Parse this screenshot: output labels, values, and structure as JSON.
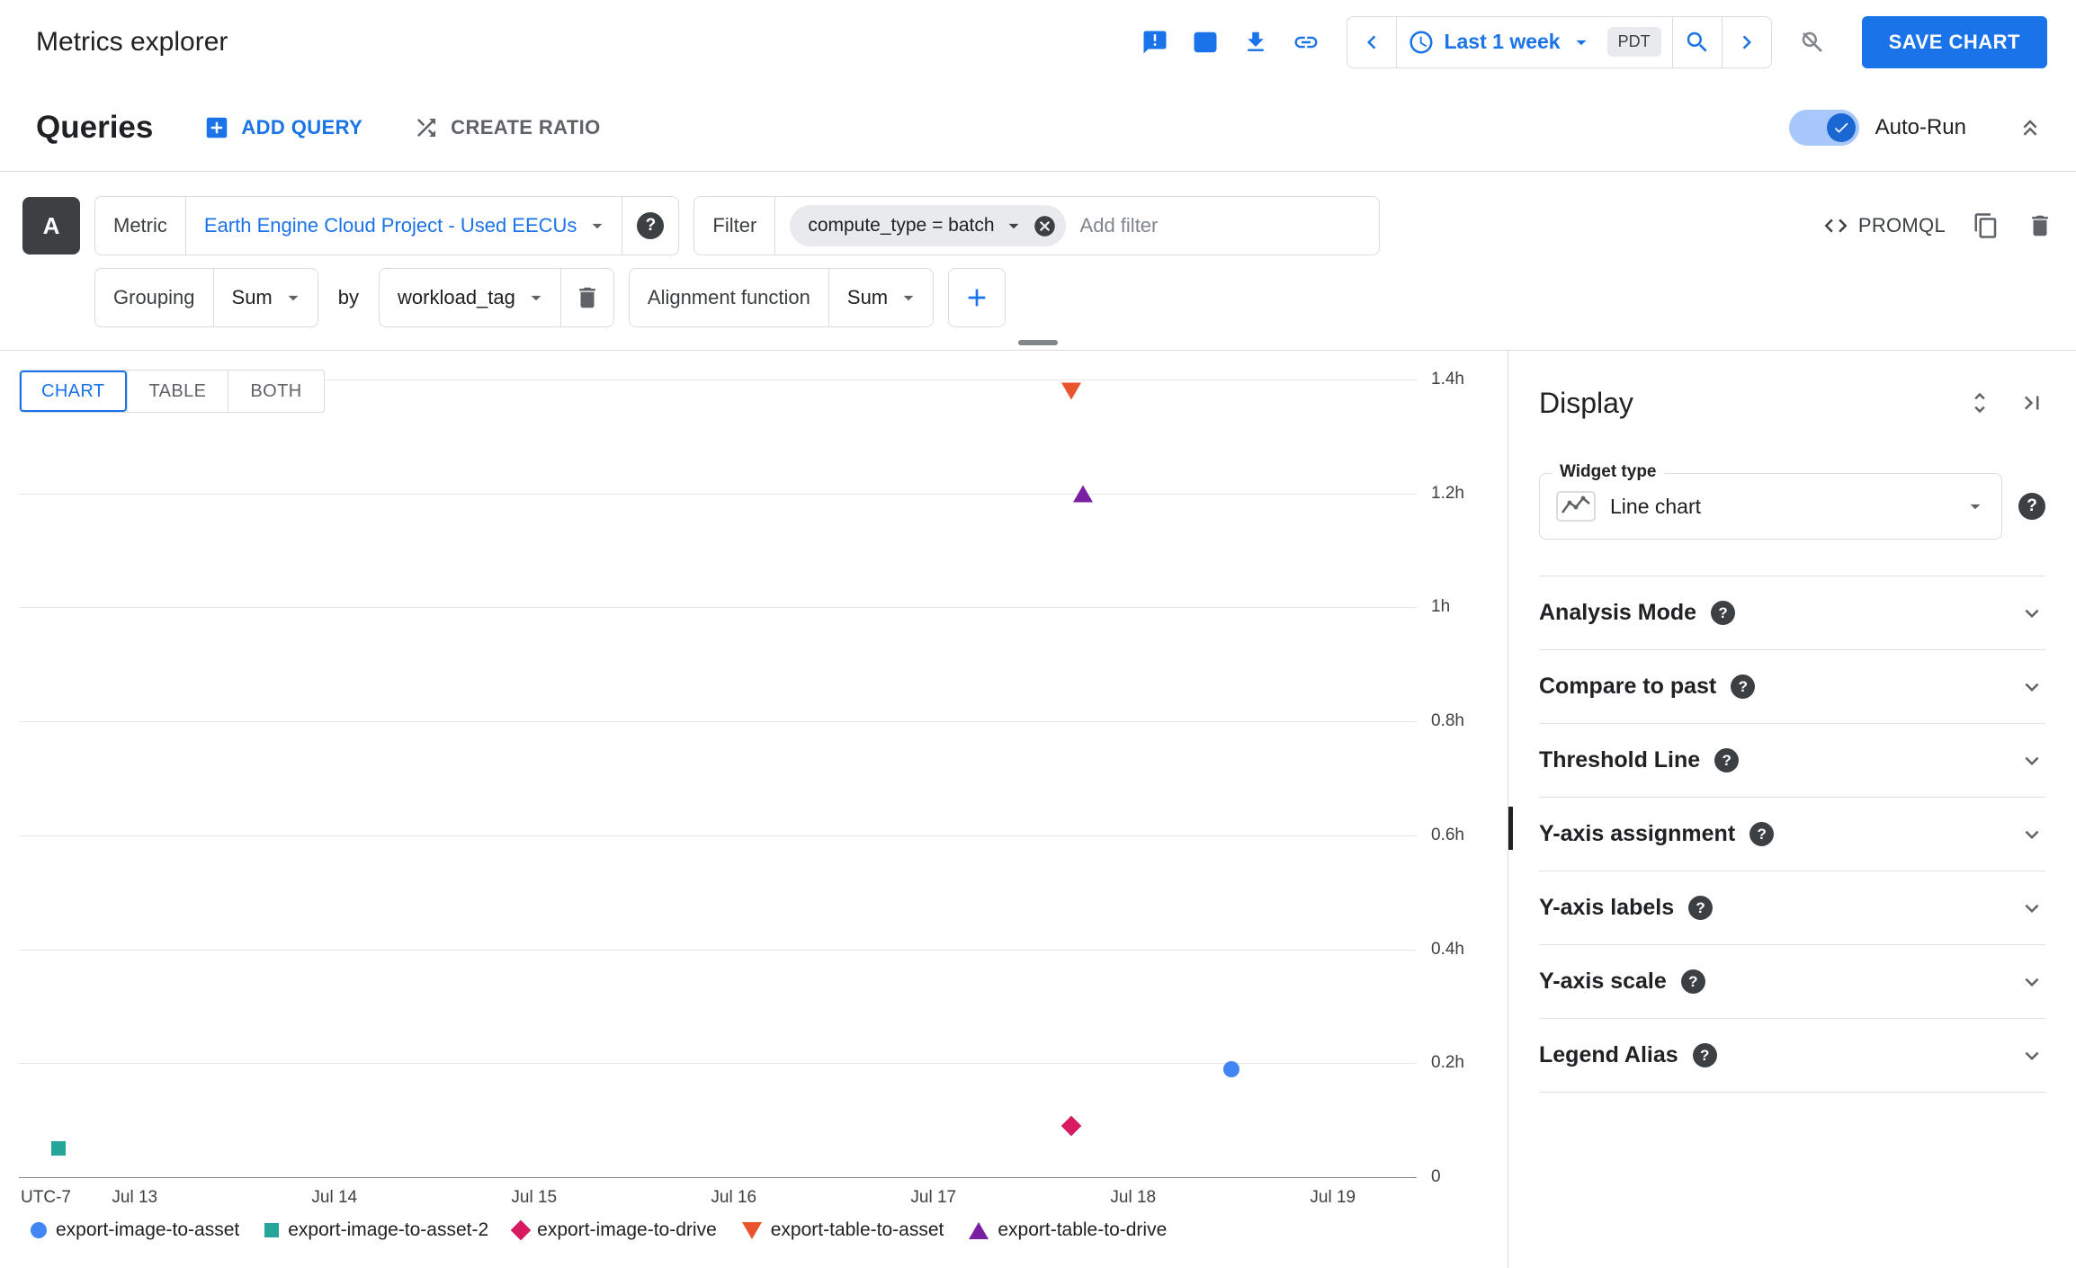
{
  "header": {
    "title": "Metrics explorer",
    "time_range": {
      "label": "Last 1 week",
      "timezone": "PDT"
    },
    "save_button": "SAVE CHART"
  },
  "queries_bar": {
    "title": "Queries",
    "add_query_label": "ADD QUERY",
    "create_ratio_label": "CREATE RATIO",
    "autorun_label": "Auto-Run",
    "autorun_enabled": true
  },
  "query": {
    "badge": "A",
    "metric_label": "Metric",
    "metric_value": "Earth Engine Cloud Project - Used EECUs",
    "filter_label": "Filter",
    "filter_chip": "compute_type = batch",
    "add_filter_placeholder": "Add filter",
    "promql_label": "PROMQL",
    "grouping_label": "Grouping",
    "grouping_value": "Sum",
    "by_label": "by",
    "group_by_value": "workload_tag",
    "alignment_label": "Alignment function",
    "alignment_value": "Sum"
  },
  "view_tabs": [
    {
      "label": "CHART",
      "active": true
    },
    {
      "label": "TABLE",
      "active": false
    },
    {
      "label": "BOTH",
      "active": false
    }
  ],
  "chart_data": {
    "type": "scatter",
    "title": "",
    "xlabel": "",
    "ylabel": "",
    "x_axis_prefix_label": "UTC-7",
    "x_ticks": [
      "Jul 13",
      "Jul 14",
      "Jul 15",
      "Jul 16",
      "Jul 17",
      "Jul 18",
      "Jul 19"
    ],
    "x_tick_days": [
      13,
      14,
      15,
      16,
      17,
      18,
      19
    ],
    "x_range_days": [
      12.42,
      19.42
    ],
    "y_ticks": [
      "1.4h",
      "1.2h",
      "1h",
      "0.8h",
      "0.6h",
      "0.4h",
      "0.2h",
      "0"
    ],
    "y_tick_values": [
      1.4,
      1.2,
      1,
      0.8,
      0.6,
      0.4,
      0.2,
      0
    ],
    "y_range": [
      0,
      1.4
    ],
    "y_unit": "hours",
    "grid": true,
    "legend_position": "bottom",
    "series": [
      {
        "name": "export-image-to-asset",
        "marker": "circle",
        "color": "#4285f4",
        "points": [
          {
            "x_day": 18.49,
            "y_hours": 0.19
          }
        ]
      },
      {
        "name": "export-image-to-asset-2",
        "marker": "square",
        "color": "#26a69a",
        "points": [
          {
            "x_day": 12.62,
            "y_hours": 0.05
          }
        ]
      },
      {
        "name": "export-image-to-drive",
        "marker": "diamond",
        "color": "#d81b60",
        "points": [
          {
            "x_day": 17.69,
            "y_hours": 0.09
          }
        ]
      },
      {
        "name": "export-table-to-asset",
        "marker": "triangle-down",
        "color": "#e8542c",
        "points": [
          {
            "x_day": 17.69,
            "y_hours": 1.38
          }
        ]
      },
      {
        "name": "export-table-to-drive",
        "marker": "triangle-up",
        "color": "#7b1fa2",
        "points": [
          {
            "x_day": 17.75,
            "y_hours": 1.2
          }
        ]
      }
    ]
  },
  "display_panel": {
    "title": "Display",
    "widget_type_label": "Widget type",
    "widget_type_value": "Line chart",
    "sections": [
      "Analysis Mode",
      "Compare to past",
      "Threshold Line",
      "Y-axis assignment",
      "Y-axis labels",
      "Y-axis scale",
      "Legend Alias"
    ]
  },
  "icons": {
    "feedback-icon": "speech-bubble-exclamation",
    "embed-code-icon": "code-in-box",
    "download-icon": "arrow-down-to-bar",
    "link-icon": "chain-link",
    "clock-icon": "clock-face",
    "chevron-left-icon": "‹",
    "chevron-right-icon": "›",
    "caret-down-icon": "▾",
    "zoom-in-icon": "magnifier",
    "zoom-disabled-icon": "magnifier-slashed",
    "add-box-icon": "plus-in-square",
    "ratio-icon": "crossing-arrows",
    "collapse-icon": "double-chevron-up",
    "check-icon": "✓",
    "help-icon": "? in dark circle",
    "cancel-icon": "x-in-circle",
    "copy-icon": "two-pages",
    "delete-icon": "trash-can",
    "promql-code-icon": "<>",
    "plus-icon": "+",
    "unfold-icon": "up-down-arrows",
    "panel-collapse-icon": "arrow-to-bar",
    "line-chart-icon": "zigzag-sparkline",
    "chevron-down-icon": "▾"
  },
  "colors": {
    "accent": "#1a73e8",
    "text_primary": "#202124",
    "text_secondary": "#5f6368",
    "border": "#dadce0",
    "badge_bg": "#3c4043",
    "chip_bg": "#e8eaed"
  }
}
